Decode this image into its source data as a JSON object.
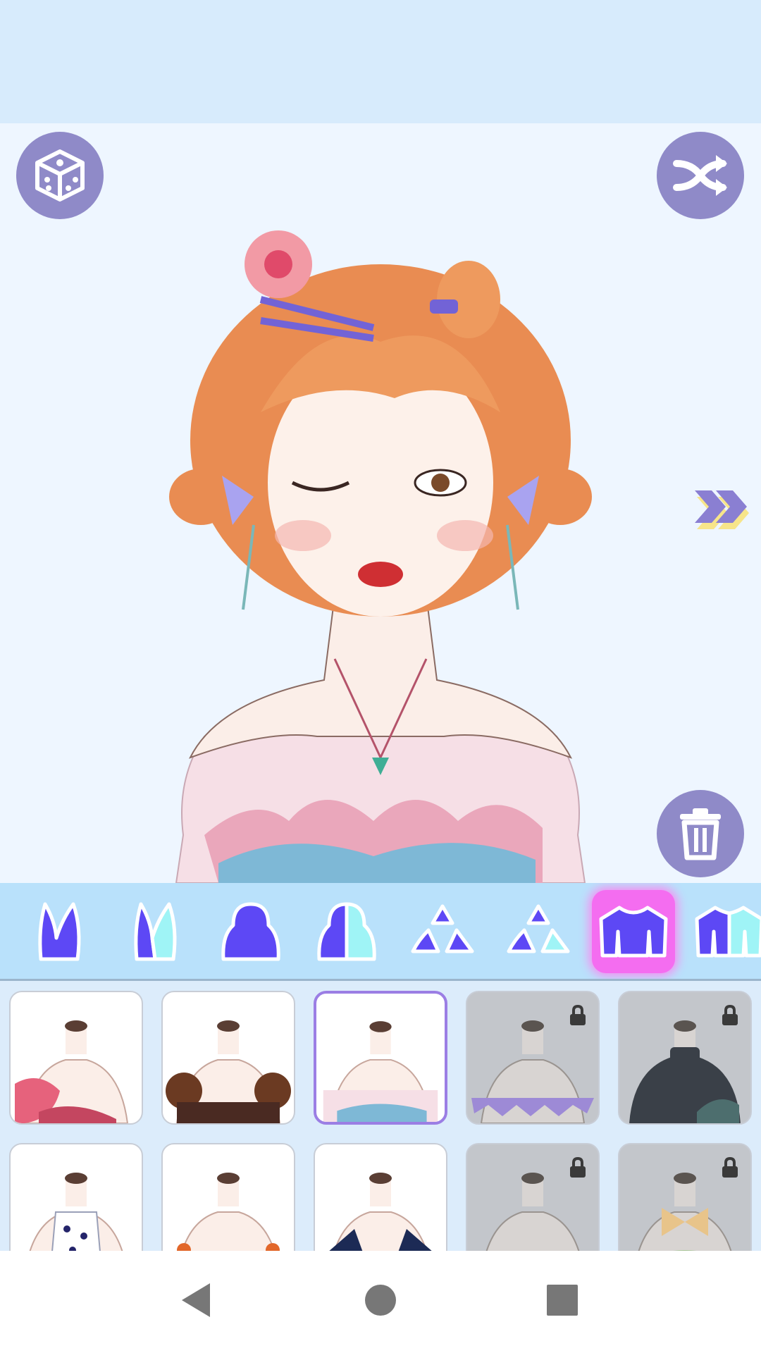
{
  "ad_banner": {},
  "toolbar": {
    "random_icon": "dice-icon",
    "shuffle_icon": "shuffle-icon",
    "delete_icon": "trash-icon",
    "next_icon": "double-chevron-right-icon"
  },
  "categories": [
    {
      "id": "bunny-ears",
      "icon": "bunny-ears-icon",
      "selected": false
    },
    {
      "id": "bunny-ears-2",
      "icon": "bunny-ears-half-icon",
      "selected": false
    },
    {
      "id": "hair",
      "icon": "head-icon",
      "selected": false
    },
    {
      "id": "hair-2",
      "icon": "head-half-icon",
      "selected": false
    },
    {
      "id": "accessory",
      "icon": "triangles-icon",
      "selected": false
    },
    {
      "id": "accessory-2",
      "icon": "triangles-half-icon",
      "selected": false
    },
    {
      "id": "top",
      "icon": "shirt-icon",
      "selected": true
    },
    {
      "id": "top-2",
      "icon": "shirt-half-icon",
      "selected": false
    }
  ],
  "outfits": [
    {
      "name": "pink-bow-top",
      "locked": false,
      "selected": false,
      "color": "#e6627c"
    },
    {
      "name": "brown-fur-top",
      "locked": false,
      "selected": false,
      "color": "#4a2a22"
    },
    {
      "name": "pink-feather-top",
      "locked": false,
      "selected": true,
      "color": "#f0c6d6"
    },
    {
      "name": "purple-scallop-top",
      "locked": true,
      "selected": false,
      "color": "#9d8ad6"
    },
    {
      "name": "dark-turtleneck-top",
      "locked": true,
      "selected": false,
      "color": "#3a4048"
    },
    {
      "name": "heart-print-top",
      "locked": false,
      "selected": false,
      "color": "#24246a"
    },
    {
      "name": "orange-flower-top",
      "locked": false,
      "selected": false,
      "color": "#e2672a"
    },
    {
      "name": "navy-blazer-top",
      "locked": false,
      "selected": false,
      "color": "#1c2a55"
    },
    {
      "name": "pink-ribbon-top",
      "locked": true,
      "selected": false,
      "color": "#d68a9a"
    },
    {
      "name": "yellow-bow-top",
      "locked": true,
      "selected": false,
      "color": "#e8c48a"
    }
  ],
  "navigation": {
    "back_icon": "back-triangle-icon",
    "home_icon": "home-circle-icon",
    "recents_icon": "recents-square-icon"
  },
  "colors": {
    "accent": "#5d48f5",
    "button": "#8f8ac8",
    "highlight": "#f46df0",
    "cyan": "#9ff4f6"
  }
}
